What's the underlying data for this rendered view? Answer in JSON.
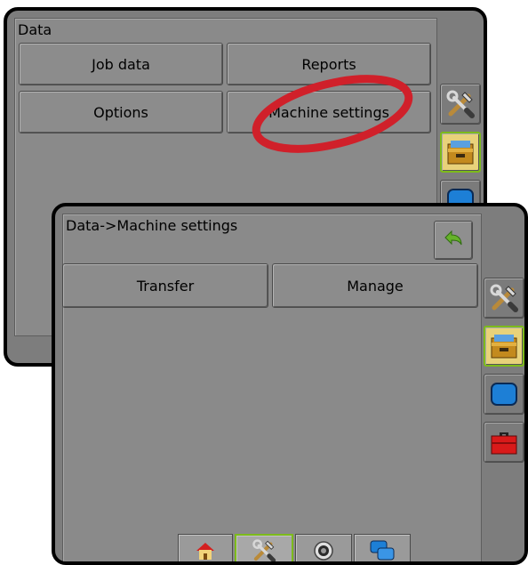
{
  "back_screen": {
    "title": "Data",
    "buttons": {
      "job_data": "Job data",
      "reports": "Reports",
      "options": "Options",
      "machine_settings": "Machine settings"
    }
  },
  "front_screen": {
    "title": "Data->Machine settings",
    "buttons": {
      "transfer": "Transfer",
      "manage": "Manage"
    }
  },
  "side_icons": [
    "tools-icon",
    "data-archive-icon",
    "screen-icon",
    "toolbox-icon"
  ],
  "bottom_tabs": [
    "home-icon",
    "tools-icon",
    "gps-icon",
    "screens-icon"
  ],
  "colors": {
    "highlight_circle": "#d0202a",
    "active_border": "#7dbb1a",
    "back_arrow": "#66b22a"
  }
}
